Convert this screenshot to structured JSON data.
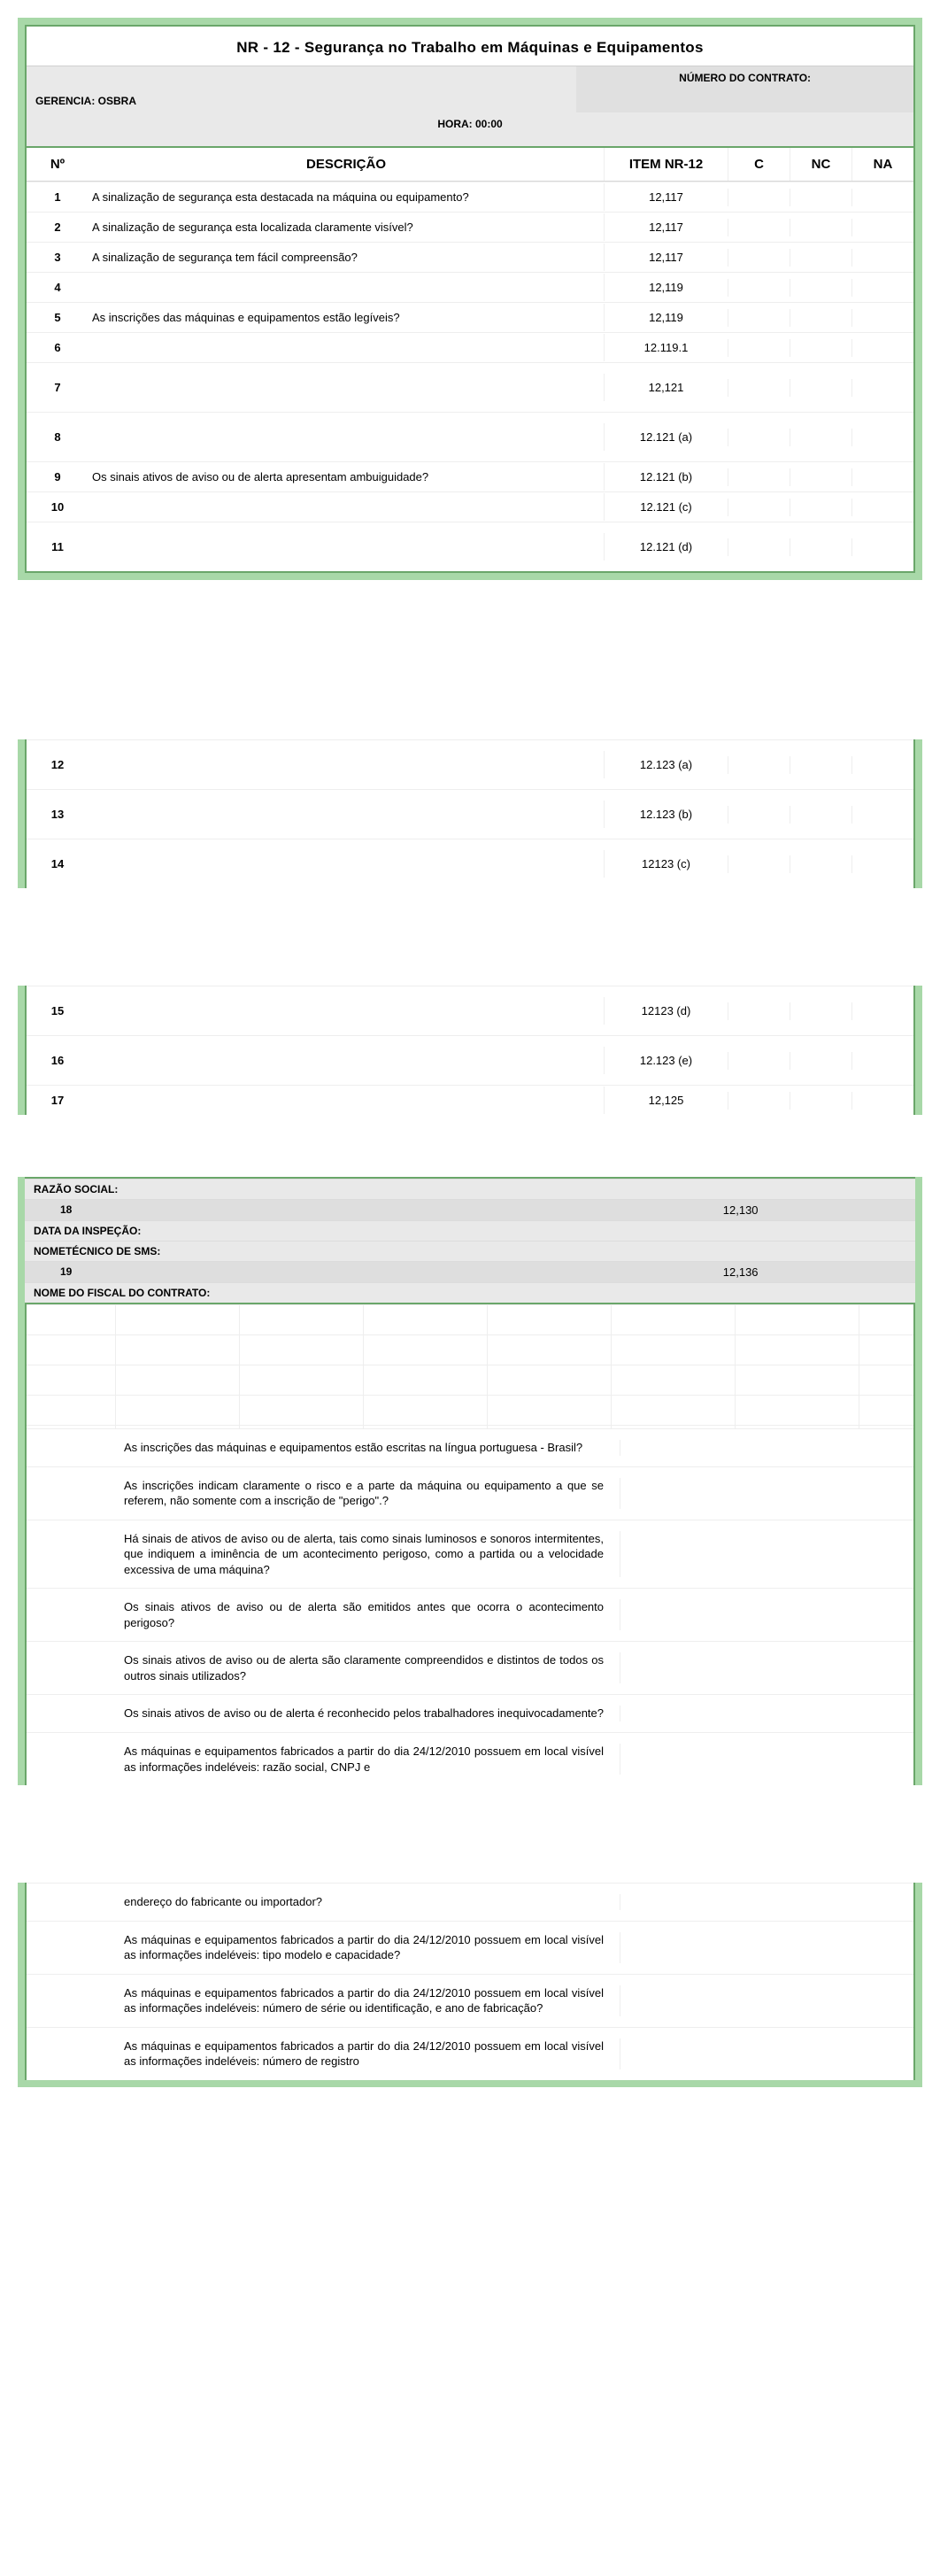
{
  "title": "NR - 12 - Segurança no Trabalho em   Máquinas e Equipamentos",
  "meta": {
    "gerencia_label": "GERENCIA:  OSBRA",
    "contrato_label": "NÚMERO DO CONTRATO:",
    "hora_label": "HORA: 00:00"
  },
  "headers": {
    "n": "Nº",
    "desc": "DESCRIÇÃO",
    "item": "ITEM NR-12",
    "c": "C",
    "nc": "NC",
    "na": "NA"
  },
  "rows1": [
    {
      "n": "1",
      "desc": "A sinalização de segurança esta destacada na máquina ou equipamento?",
      "item": "12,117"
    },
    {
      "n": "2",
      "desc": "A sinalização de segurança esta localizada claramente visível?",
      "item": "12,117"
    },
    {
      "n": "3",
      "desc": "A sinalização de segurança tem fácil compreensão?",
      "item": "12,117"
    },
    {
      "n": "4",
      "desc": "",
      "item": "12,119"
    },
    {
      "n": "5",
      "desc": "As inscrições das máquinas e equipamentos estão legíveis?",
      "item": "12,119"
    },
    {
      "n": "6",
      "desc": "",
      "item": "12.119.1"
    },
    {
      "n": "7",
      "desc": "",
      "item": "12,121",
      "tall": true
    },
    {
      "n": "8",
      "desc": "",
      "item": "12.121 (a)",
      "tall": true
    },
    {
      "n": "9",
      "desc": "Os sinais ativos de aviso ou de alerta apresentam ambuiguidade?",
      "item": "12.121 (b)"
    },
    {
      "n": "10",
      "desc": "",
      "item": "12.121 (c)"
    },
    {
      "n": "11",
      "desc": "",
      "item": "12.121 (d)",
      "tall": true
    }
  ],
  "rows2": [
    {
      "n": "12",
      "desc": "",
      "item": "12.123 (a)",
      "tall": true
    },
    {
      "n": "13",
      "desc": "",
      "item": "12.123 (b)",
      "tall": true
    },
    {
      "n": "14",
      "desc": "",
      "item": "12123 (c)",
      "tall": true
    }
  ],
  "rows3": [
    {
      "n": "15",
      "desc": "",
      "item": "12123 (d)",
      "tall": true
    },
    {
      "n": "16",
      "desc": "",
      "item": "12.123 (e)",
      "tall": true
    },
    {
      "n": "17",
      "desc": "",
      "item": "12,125"
    }
  ],
  "meta2": {
    "razao_label": "RAZÃO SOCIAL:",
    "row18_n": "18",
    "row18_item": "12,130",
    "data_insp_label": "DATA DA INSPEÇÃO:",
    "nome_tec_label": "NOMETÉCNICO DE SMS:",
    "row19_n": "19",
    "row19_item": "12,136",
    "nome_fiscal_label": "NOME DO FISCAL DO CONTRATO:"
  },
  "paragraphs1": [
    "As inscrições das máquinas e equipamentos estão escritas na língua portuguesa - Brasil?",
    "As inscrições indicam claramente o risco e a parte da máquina ou equipamento a que se referem, não somente com a inscrição de \"perigo\".?",
    "Há sinais de ativos de aviso ou de alerta, tais como sinais luminosos e sonoros intermitentes, que indiquem a iminência de um acontecimento perigoso, como a partida ou a velocidade excessiva de uma máquina?",
    "Os sinais ativos de aviso ou de alerta são emitidos antes que ocorra o acontecimento perigoso?",
    "Os sinais ativos de aviso ou de alerta são claramente compreendidos e distintos de todos os outros sinais utilizados?",
    "Os sinais ativos de aviso ou de alerta é reconhecido pelos trabalhadores inequivocadamente?",
    "As máquinas e equipamentos fabricados a partir do dia 24/12/2010 possuem em local visível as informações indeléveis: razão social, CNPJ e"
  ],
  "paragraphs2": [
    "endereço do fabricante ou importador?",
    "As máquinas e equipamentos fabricados a partir do dia 24/12/2010 possuem em local visível as informações indeléveis: tipo modelo e capacidade?",
    "As máquinas e equipamentos fabricados a partir do dia 24/12/2010 possuem em local visível as informações indeléveis: número de série ou identificação, e ano de fabricação?",
    "As máquinas e equipamentos fabricados a partir do dia 24/12/2010 possuem em local visível as informações indeléveis: número de registro"
  ]
}
